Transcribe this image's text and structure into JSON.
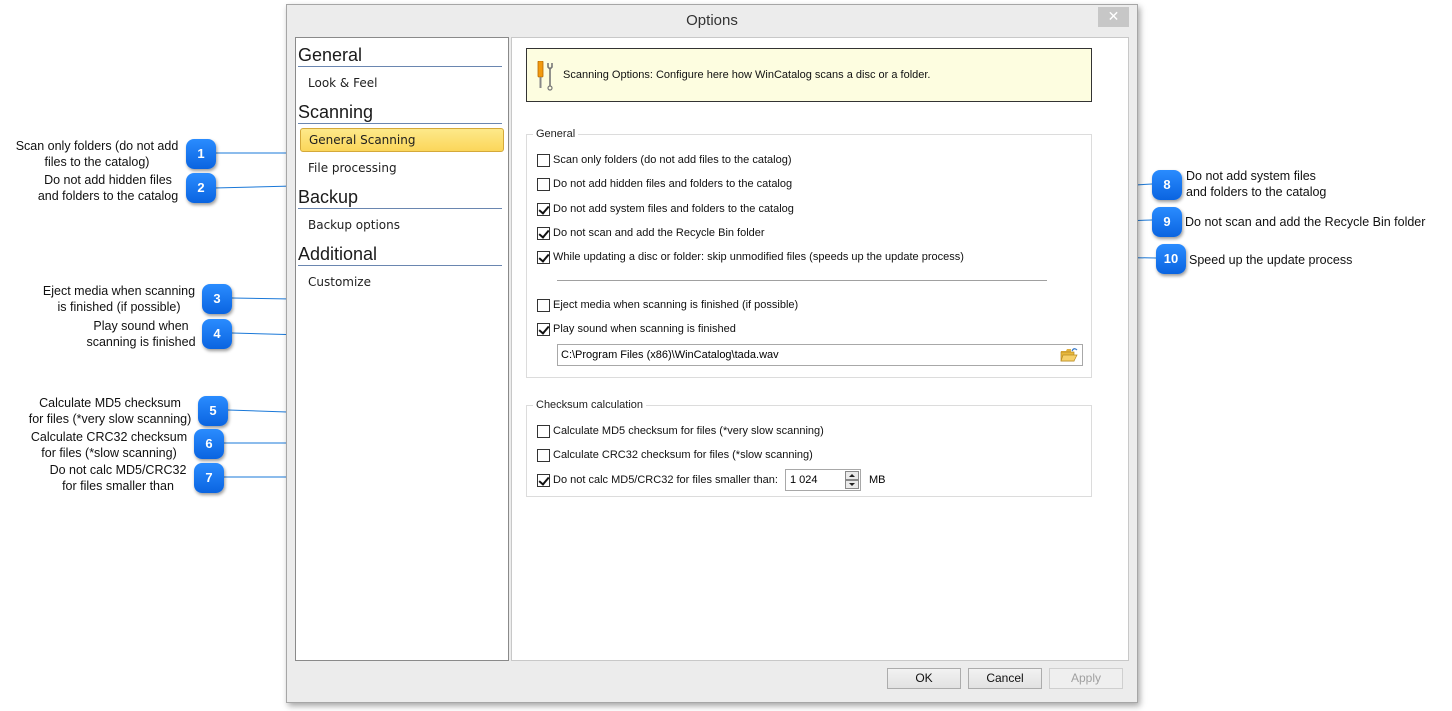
{
  "window": {
    "title": "Options",
    "close_label": "✕"
  },
  "nav": {
    "sections": [
      {
        "header": "General",
        "items": [
          {
            "label": "Look & Feel",
            "selected": false
          }
        ]
      },
      {
        "header": "Scanning",
        "items": [
          {
            "label": "General Scanning",
            "selected": true
          },
          {
            "label": "File processing",
            "selected": false
          }
        ]
      },
      {
        "header": "Backup",
        "items": [
          {
            "label": "Backup options",
            "selected": false
          }
        ]
      },
      {
        "header": "Additional",
        "items": [
          {
            "label": "Customize",
            "selected": false
          }
        ]
      }
    ]
  },
  "banner": {
    "icon": "tools-icon",
    "text": "Scanning Options: Configure here how WinCatalog scans a disc or a folder."
  },
  "general_group": {
    "title": "General",
    "options": [
      {
        "label": "Scan only folders (do not add files to the catalog)",
        "checked": false
      },
      {
        "label": "Do not add hidden files and folders to the catalog",
        "checked": false
      },
      {
        "label": "Do not add system files and folders to the catalog",
        "checked": true
      },
      {
        "label": "Do not scan and add the Recycle Bin folder",
        "checked": true
      },
      {
        "label": "While updating a disc or folder: skip unmodified files (speeds up the update process)",
        "checked": true
      },
      {
        "label": "Eject media when scanning is finished (if possible)",
        "checked": false
      },
      {
        "label": "Play sound when scanning is finished",
        "checked": true
      }
    ],
    "sound_path": "C:\\Program Files (x86)\\WinCatalog\\tada.wav",
    "browse_icon": "folder-open-icon"
  },
  "checksum_group": {
    "title": "Checksum calculation",
    "options": [
      {
        "label": "Calculate MD5 checksum for files (*very slow scanning)",
        "checked": false
      },
      {
        "label": "Calculate CRC32 checksum for files (*slow scanning)",
        "checked": false
      },
      {
        "label": "Do not calc MD5/CRC32 for files smaller than:",
        "checked": true
      }
    ],
    "min_size_value": "1 024",
    "min_size_unit": "MB"
  },
  "buttons": {
    "ok": "OK",
    "cancel": "Cancel",
    "apply": "Apply"
  },
  "callouts": [
    {
      "number": "1",
      "text_line1": "Scan only folders (do not add",
      "text_line2": "files to the catalog)"
    },
    {
      "number": "2",
      "text_line1": "Do not add hidden files",
      "text_line2": "and folders to the catalog"
    },
    {
      "number": "3",
      "text_line1": "Eject media when scanning",
      "text_line2": "is finished (if possible)"
    },
    {
      "number": "4",
      "text_line1": "Play sound when",
      "text_line2": "scanning is finished"
    },
    {
      "number": "5",
      "text_line1": "Calculate MD5 checksum",
      "text_line2": "for files (*very slow scanning)"
    },
    {
      "number": "6",
      "text_line1": "Calculate CRC32 checksum",
      "text_line2": "for files (*slow scanning)"
    },
    {
      "number": "7",
      "text_line1": "Do not calc MD5/CRC32",
      "text_line2": "for files smaller than"
    },
    {
      "number": "8",
      "text_line1": "Do not add system files",
      "text_line2": "and folders to the catalog"
    },
    {
      "number": "9",
      "text_line1": "Do not scan and add the Recycle Bin folder",
      "text_line2": ""
    },
    {
      "number": "10",
      "text_line1": "Speed up the update process",
      "text_line2": ""
    }
  ],
  "colors": {
    "callout_blue": "#0a6ee8",
    "selected_item": "#fbd65a",
    "banner_bg": "#fdfde0"
  }
}
